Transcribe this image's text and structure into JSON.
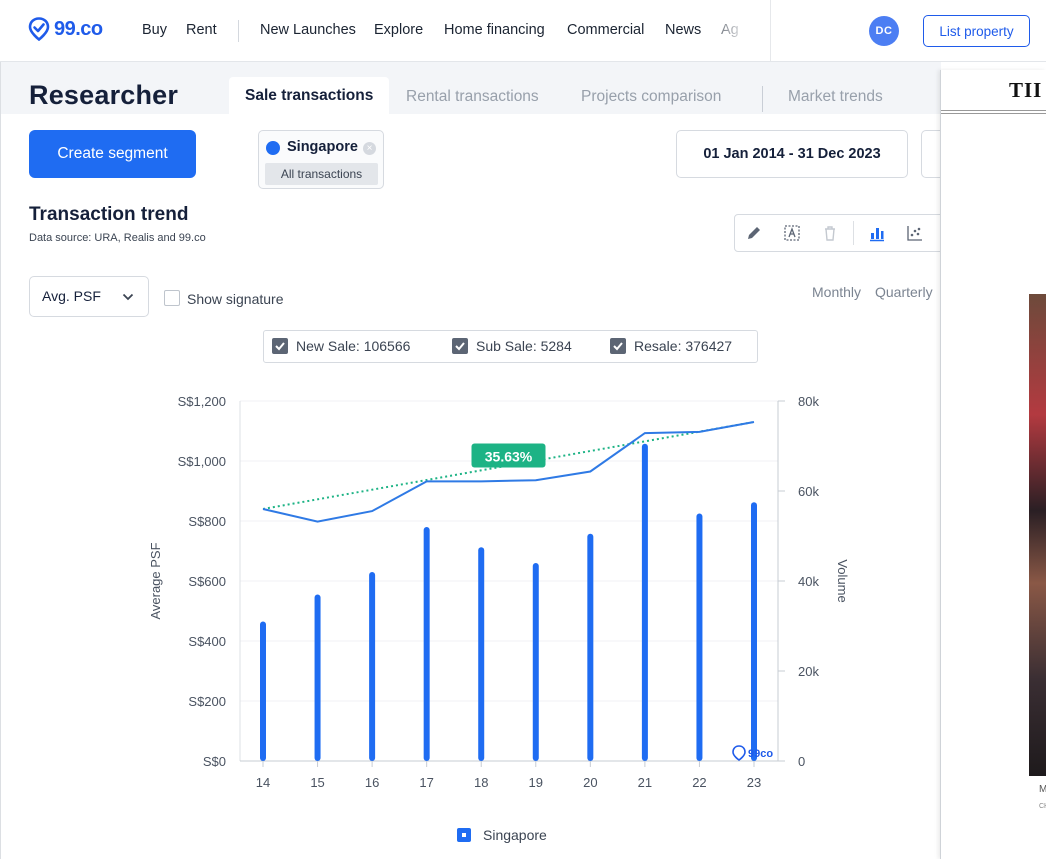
{
  "nav": {
    "logo": "99.co",
    "links": [
      "Buy",
      "Rent",
      "New Launches",
      "Explore",
      "Home financing",
      "Commercial",
      "News",
      "Ag"
    ],
    "avatar_initials": "DC",
    "list_property": "List property"
  },
  "page": {
    "title": "Researcher",
    "tabs": [
      "Sale transactions",
      "Rental transactions",
      "Projects comparison",
      "Market trends"
    ],
    "active_tab": "Sale transactions",
    "create_segment": "Create segment",
    "segment": {
      "name": "Singapore",
      "tag": "All transactions",
      "remove": "×",
      "color": "#1f6cf2"
    },
    "date_range": "01 Jan 2014 - 31 Dec 2023"
  },
  "trend": {
    "title": "Transaction trend",
    "source": "Data source: URA, Realis and 99.co",
    "metric": "Avg. PSF",
    "show_signature": "Show signature",
    "periods": [
      "Monthly",
      "Quarterly"
    ],
    "toolbar_icons": [
      "pencil-icon",
      "text-box-icon",
      "trash-icon",
      "bar-chart-icon",
      "scatter-icon"
    ]
  },
  "filters": [
    {
      "label": "New Sale: 106566",
      "checked": true
    },
    {
      "label": "Sub Sale: 5284",
      "checked": true
    },
    {
      "label": "Resale: 376427",
      "checked": true
    }
  ],
  "chart_data": {
    "type": "bar",
    "categories": [
      "14",
      "15",
      "16",
      "17",
      "18",
      "19",
      "20",
      "21",
      "22",
      "23"
    ],
    "series": [
      {
        "name": "Singapore",
        "kind": "bar",
        "axis": "right",
        "values": [
          31000,
          37000,
          42000,
          52000,
          47500,
          44000,
          50500,
          70500,
          55000,
          57500
        ]
      },
      {
        "name": "Singapore",
        "kind": "line",
        "axis": "left",
        "values": [
          840,
          798,
          833,
          932,
          932,
          936,
          965,
          1093,
          1097,
          1130
        ]
      }
    ],
    "trendline": {
      "start": 840,
      "end": 1130,
      "label": "35.63%"
    },
    "ylabel": "Average PSF",
    "y2label": "Volume",
    "yticks": [
      "S$0",
      "S$200",
      "S$400",
      "S$600",
      "S$800",
      "S$1,000",
      "S$1,200"
    ],
    "y2ticks": [
      "0",
      "20k",
      "40k",
      "60k",
      "80k"
    ],
    "ylim": [
      0,
      1200
    ],
    "y2lim": [
      0,
      80000
    ],
    "legend": "Singapore",
    "legend_placement": "bottom",
    "watermark": "99co",
    "grid": true,
    "colors": {
      "bar": "#1f6cf2",
      "line": "#2f7ae5",
      "trend": "#1db385"
    }
  },
  "side": {
    "masthead": "TII",
    "caption": "M",
    "credit": "CH"
  }
}
